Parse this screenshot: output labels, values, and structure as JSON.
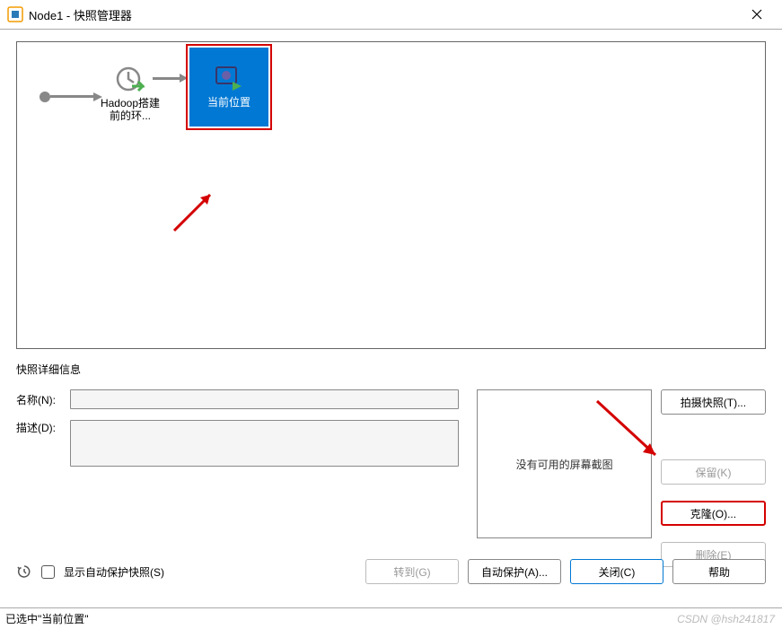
{
  "window": {
    "title": "Node1 - 快照管理器",
    "close_icon": "close-icon"
  },
  "timeline": {
    "snapshot_label": "Hadoop搭建前的环...",
    "current_label": "当前位置"
  },
  "details": {
    "panel_title": "快照详细信息",
    "name_label": "名称(N):",
    "name_value": "",
    "desc_label": "描述(D):",
    "desc_value": "",
    "screenshot_placeholder": "没有可用的屏幕截图"
  },
  "right_buttons": {
    "take_snapshot": "拍摄快照(T)...",
    "keep": "保留(K)",
    "clone": "克隆(O)...",
    "delete": "删除(E)"
  },
  "bottom": {
    "autoprotect_label": "显示自动保护快照(S)",
    "goto": "转到(G)",
    "autoprotect": "自动保护(A)...",
    "close": "关闭(C)",
    "help": "帮助"
  },
  "status": {
    "text": "已选中\"当前位置\"",
    "watermark": "CSDN @hsh241817"
  }
}
